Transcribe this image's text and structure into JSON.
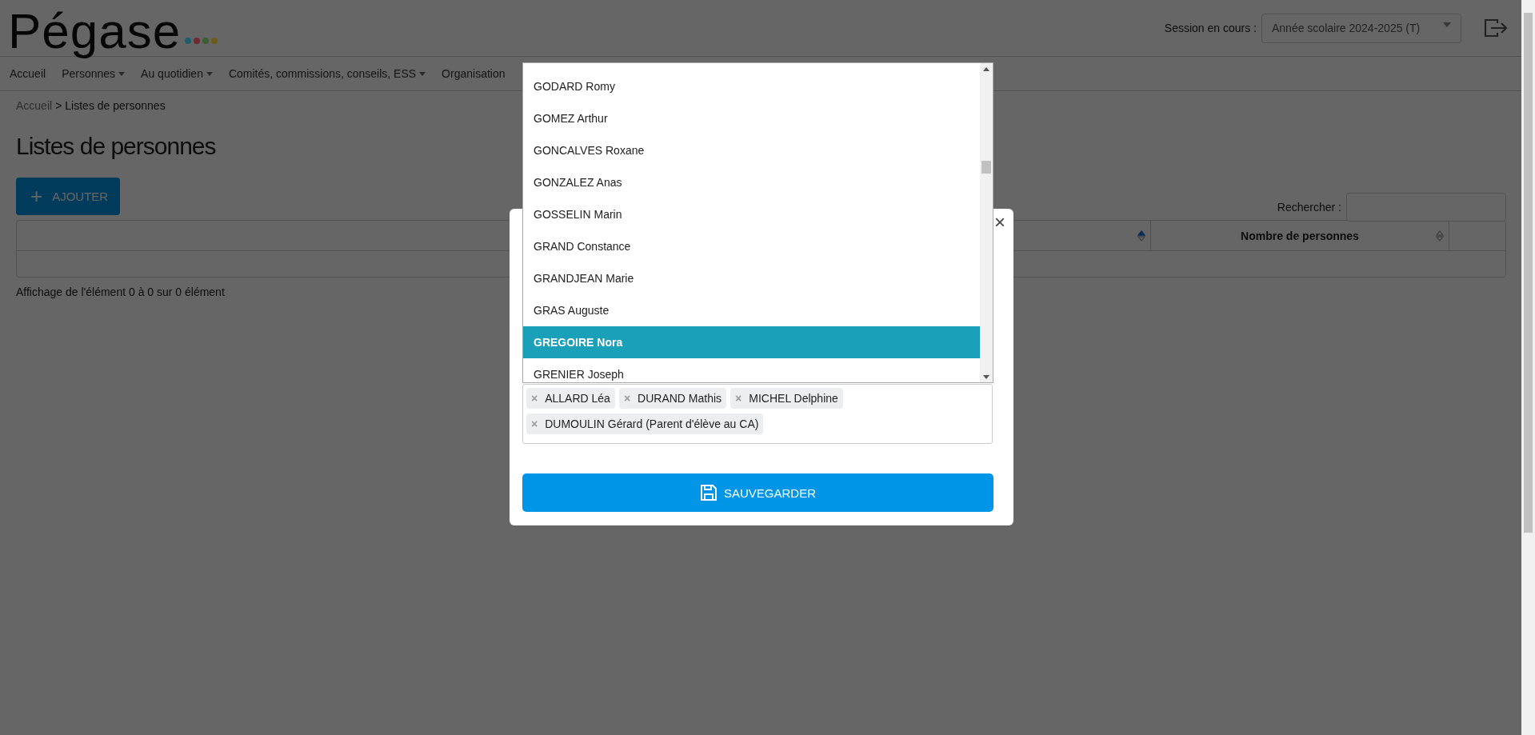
{
  "header": {
    "logo": "Pégase",
    "logo_dots": [
      {
        "color": "#1a5f6b"
      },
      {
        "color": "#6e2a33"
      },
      {
        "color": "#3a5e2f"
      },
      {
        "color": "#6e5a1f"
      }
    ],
    "session_label": "Session en cours :",
    "session_value": "Année scolaire 2024-2025 (T)"
  },
  "nav": [
    {
      "label": "Accueil",
      "dropdown": false
    },
    {
      "label": "Personnes",
      "dropdown": true
    },
    {
      "label": "Au quotidien",
      "dropdown": true
    },
    {
      "label": "Comités, commissions, conseils, ESS",
      "dropdown": true
    },
    {
      "label": "Organisation",
      "dropdown": false
    }
  ],
  "breadcrumb": {
    "link": "Accueil",
    "separator": ">",
    "current": "Listes de personnes"
  },
  "page_title": "Listes de personnes",
  "add_button": {
    "icon": "+",
    "label": "AJOUTER"
  },
  "search": {
    "label": "Rechercher :"
  },
  "table": {
    "columns": [
      {
        "kind": "sortable",
        "sorted": true
      },
      {
        "kind": "sortable",
        "label": "Nombre de personnes",
        "sorted": false
      },
      {
        "kind": "blank"
      }
    ]
  },
  "table_info": "Affichage de l'élément 0 à 0 sur 0 élément",
  "modal": {
    "close": "×",
    "options": [
      {
        "label": "GODARD Romy",
        "selected": false
      },
      {
        "label": "GOMEZ Arthur",
        "selected": false
      },
      {
        "label": "GONCALVES Roxane",
        "selected": false
      },
      {
        "label": "GONZALEZ Anas",
        "selected": false
      },
      {
        "label": "GOSSELIN Marin",
        "selected": false
      },
      {
        "label": "GRAND Constance",
        "selected": false
      },
      {
        "label": "GRANDJEAN Marie",
        "selected": false
      },
      {
        "label": "GRAS Auguste",
        "selected": false
      },
      {
        "label": "GREGOIRE Nora",
        "selected": true
      },
      {
        "label": "GRENIER Joseph",
        "selected": false
      }
    ],
    "tags": [
      {
        "remove": "×",
        "label": "ALLARD Léa"
      },
      {
        "remove": "×",
        "label": "DURAND Mathis"
      },
      {
        "remove": "×",
        "label": "MICHEL Delphine"
      },
      {
        "remove": "×",
        "label": "DUMOULIN Gérard (Parent d'élève au CA)"
      }
    ],
    "save_button": "SAUVEGARDER"
  }
}
